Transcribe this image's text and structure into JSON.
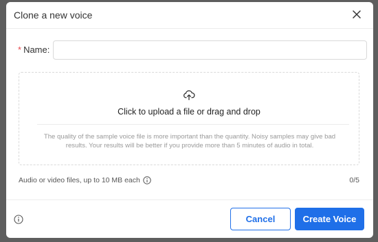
{
  "dialog": {
    "title": "Clone a new voice"
  },
  "form": {
    "required_marker": "*",
    "name_label": "Name:",
    "name_value": ""
  },
  "upload": {
    "main_text": "Click to upload a file or drag and drop",
    "hint": "The quality of the sample voice file is more important than the quantity. Noisy samples may give bad results. Your results will be better if you provide more than 5 minutes of audio in total.",
    "limits": "Audio or video files, up to 10 MB each",
    "count": "0/5"
  },
  "footer": {
    "cancel_label": "Cancel",
    "create_label": "Create Voice"
  },
  "icons": {
    "close": "close-icon",
    "upload": "cloud-upload-icon",
    "info": "info-icon"
  },
  "colors": {
    "primary": "#1f6fe8",
    "required": "#e5484d",
    "overlay": "#5e5e5e"
  }
}
